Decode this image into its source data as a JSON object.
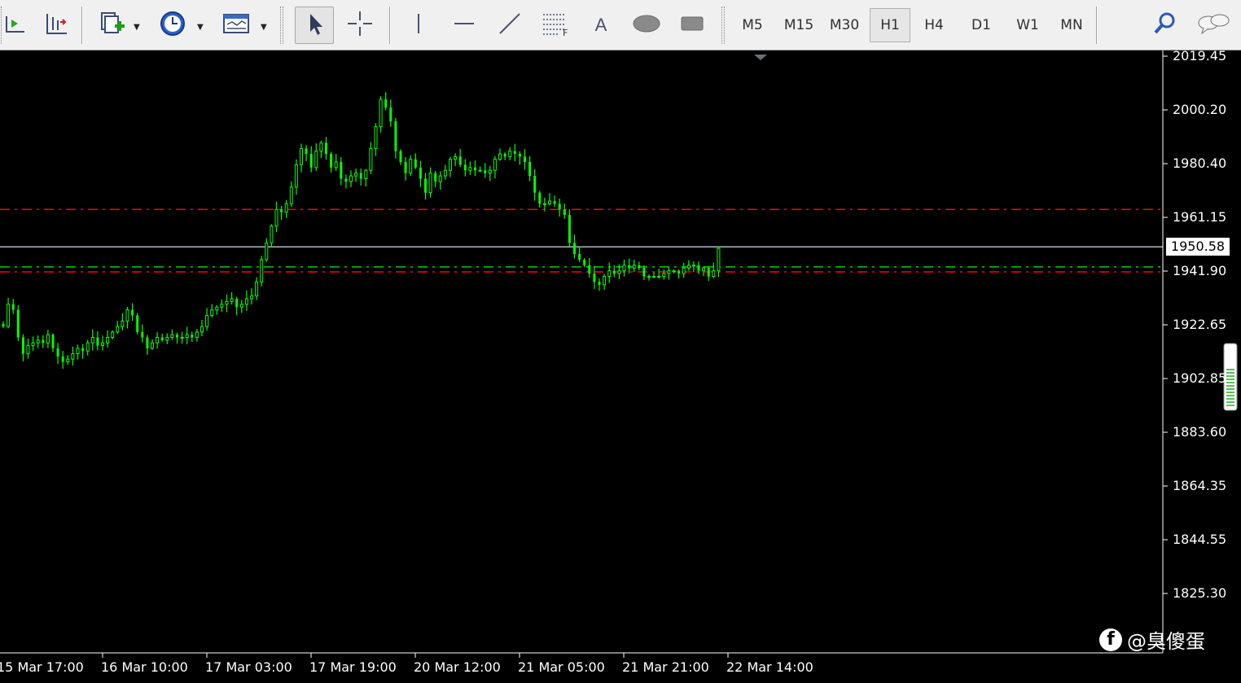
{
  "toolbar": {
    "timeframes": [
      {
        "label": "M5",
        "active": false
      },
      {
        "label": "M15",
        "active": false
      },
      {
        "label": "M30",
        "active": false
      },
      {
        "label": "H1",
        "active": true
      },
      {
        "label": "H4",
        "active": false
      },
      {
        "label": "D1",
        "active": false
      },
      {
        "label": "W1",
        "active": false
      },
      {
        "label": "MN",
        "active": false
      }
    ],
    "tools": [
      "chart-shift-icon",
      "autoscroll-icon",
      "new-chart-icon",
      "clock-icon",
      "templates-icon",
      "cursor-icon",
      "crosshair-icon",
      "vertical-line-icon",
      "horizontal-line-icon",
      "trendline-icon",
      "fibonacci-icon",
      "text-icon",
      "ellipse-icon",
      "rectangle-icon",
      "search-icon",
      "chat-icon"
    ],
    "text_tool_label": "A",
    "fibo_tool_label": "F"
  },
  "price_axis": {
    "ticks": [
      "2019.45",
      "2000.20",
      "1980.40",
      "1961.15",
      "1941.90",
      "1922.65",
      "1902.85",
      "1883.60",
      "1864.35",
      "1844.55",
      "1825.30"
    ],
    "current_price": "1950.58"
  },
  "time_axis": {
    "labels": [
      "15 Mar 17:00",
      "16 Mar 10:00",
      "17 Mar 03:00",
      "17 Mar 19:00",
      "20 Mar 12:00",
      "21 Mar 05:00",
      "21 Mar 21:00",
      "22 Mar 14:00"
    ]
  },
  "watermark": {
    "logo": "f",
    "text": "@臭傻蛋"
  },
  "chart_data": {
    "type": "candlestick",
    "timeframe": "H1",
    "ylim": [
      1825.3,
      2019.45
    ],
    "background": "#000000",
    "candle_color": "#00ff00",
    "horizontal_lines": [
      {
        "price": 1964.0,
        "color": "#ff0000",
        "style": "dash-dot"
      },
      {
        "price": 1950.58,
        "color": "#b0b8c8",
        "style": "solid"
      },
      {
        "price": 1943.4,
        "color": "#00d000",
        "style": "dash-dot"
      },
      {
        "price": 1941.6,
        "color": "#ff0000",
        "style": "dash-dot"
      }
    ],
    "closes": [
      1922,
      1930,
      1928,
      1918,
      1912,
      1915,
      1916,
      1917,
      1916,
      1919,
      1914,
      1911,
      1909,
      1910,
      1912,
      1914,
      1913,
      1916,
      1918,
      1915,
      1916,
      1918,
      1920,
      1922,
      1924,
      1928,
      1926,
      1920,
      1918,
      1914,
      1916,
      1918,
      1917,
      1918,
      1919,
      1918,
      1918,
      1919,
      1918,
      1920,
      1922,
      1926,
      1928,
      1929,
      1930,
      1931,
      1932,
      1929,
      1930,
      1932,
      1933,
      1938,
      1946,
      1952,
      1958,
      1964,
      1963,
      1966,
      1972,
      1980,
      1986,
      1984,
      1979,
      1985,
      1988,
      1984,
      1979,
      1981,
      1975,
      1974,
      1976,
      1977,
      1975,
      1978,
      1986,
      1994,
      2004,
      2001,
      1996,
      1985,
      1981,
      1977,
      1982,
      1979,
      1975,
      1970,
      1977,
      1974,
      1976,
      1978,
      1982,
      1983,
      1980,
      1978,
      1979,
      1978,
      1978,
      1977,
      1978,
      1982,
      1984,
      1983,
      1985,
      1984,
      1983,
      1981,
      1976,
      1970,
      1966,
      1966,
      1967,
      1966,
      1964,
      1962,
      1952,
      1948,
      1946,
      1944,
      1941,
      1938,
      1937,
      1940,
      1942,
      1941,
      1942,
      1944,
      1943,
      1944,
      1943,
      1940,
      1940,
      1940,
      1940,
      1941,
      1942,
      1942,
      1941,
      1943,
      1944,
      1944,
      1942,
      1943,
      1940,
      1942,
      1950
    ]
  }
}
